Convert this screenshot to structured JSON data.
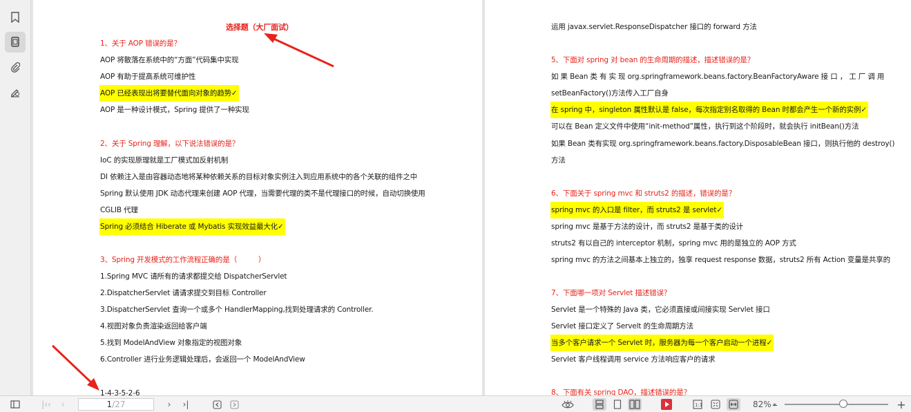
{
  "page1": {
    "title": "选择题（大厂面试）",
    "q1": "1、关于 AOP 错误的是？",
    "q1_a": "AOP 将散落在系统中的“方面”代码集中实现",
    "q1_b": "AOP 有助于提高系统可维护性",
    "q1_c": "AOP 已经表现出将要替代面向对象的趋势✓",
    "q1_d": "AOP 是一种设计模式，Spring 提供了一种实现",
    "q2": "2、关于 Spring 理解，以下说法错误的是？",
    "q2_a": "IoC 的实现原理就是工厂模式加反射机制",
    "q2_b": "DI 依赖注入是由容器动态地将某种依赖关系的目标对象实例注入到应用系统中的各个关联的组件之中",
    "q2_c1": "Spring 默认使用 JDK 动态代理来创建 AOP 代理，当需要代理的类不是代理接口的时候，自动切换使用",
    "q2_c2": "CGLIB 代理",
    "q2_d": "Spring 必须结合 Hiberate 或 Mybatis 实现效益最大化✓",
    "q3": "3、Spring 开发模式的工作流程正确的是（　　　）",
    "q3_1": "1.Spring MVC 请所有的请求都提交给 DispatcherServlet",
    "q3_2": "2.DispatcherServlet 请请求提交到目标 Controller",
    "q3_3": "3.DispatcherServlet 查询一个或多个 HandlerMapping,找到处理请求的 Controller.",
    "q3_4": "4.视图对象负责渲染返回给客户端",
    "q3_5": "5.找到 ModelAndView 对象指定的视图对象",
    "q3_6": "6.Controller 进行业务逻辑处理后，会返回一个 ModelAndView",
    "q3_ans": "1-4-3-5-2-6"
  },
  "page2": {
    "top": "运用 javax.servlet.ResponseDispatcher 接口的 forward 方法",
    "q5": "5、下面对 spring 对 bean 的生命周期的描述，描述错误的是？",
    "q5_a1": "如 果  Bean  类 有 实 现  org.springframework.beans.factory.BeanFactoryAware  接 口 ， 工 厂 调 用",
    "q5_a2": "setBeanFactory()方法传入工厂自身",
    "q5_b": "在 spring 中，singleton 属性默认是 false，每次指定别名取得的 Bean 时都会产生一个新的实例✓",
    "q5_c": "可以在 Bean 定义文件中使用“init-method”属性，执行到这个阶段时，就会执行 initBean()方法",
    "q5_d1": "如果 Bean 类有实现 org.springframework.beans.factory.DisposableBean 接口，则执行他的 destroy()",
    "q5_d2": "方法",
    "q6": "6、下面关于 spring mvc  和 struts2 的描述，错误的是？",
    "q6_a": "spring mvc 的入口是 filter，而 struts2 是 servlet✓",
    "q6_b": "spring mvc 是基于方法的设计，而 struts2 是基于类的设计",
    "q6_c": "struts2 有以自己的 interceptor 机制，spring mvc 用的是独立的 AOP 方式",
    "q6_d": "spring mvc 的方法之间基本上独立的，独享 request response 数据，struts2 所有 Action 变量是共享的",
    "q7": "7、下面哪一项对 Servlet 描述错误？",
    "q7_a": "Servlet 是一个特殊的 Java 类，它必须直接或间接实现 Servlet 接口",
    "q7_b": "Servlet 接口定义了 Servelt 的生命周期方法",
    "q7_c": "当多个客户请求一个 Servlet 时，服务器为每一个客户启动一个进程✓",
    "q7_d": "Servlet 客户线程调用 service 方法响应客户的请求",
    "q8": "8、下面有关 spring DAO，描述错误的是？"
  },
  "toolbar": {
    "page_current": "1",
    "page_total": "/27",
    "zoom": "82%"
  },
  "colors": {
    "question": "#e8231a",
    "highlight": "#ffff00",
    "arrow": "#e8231a"
  }
}
